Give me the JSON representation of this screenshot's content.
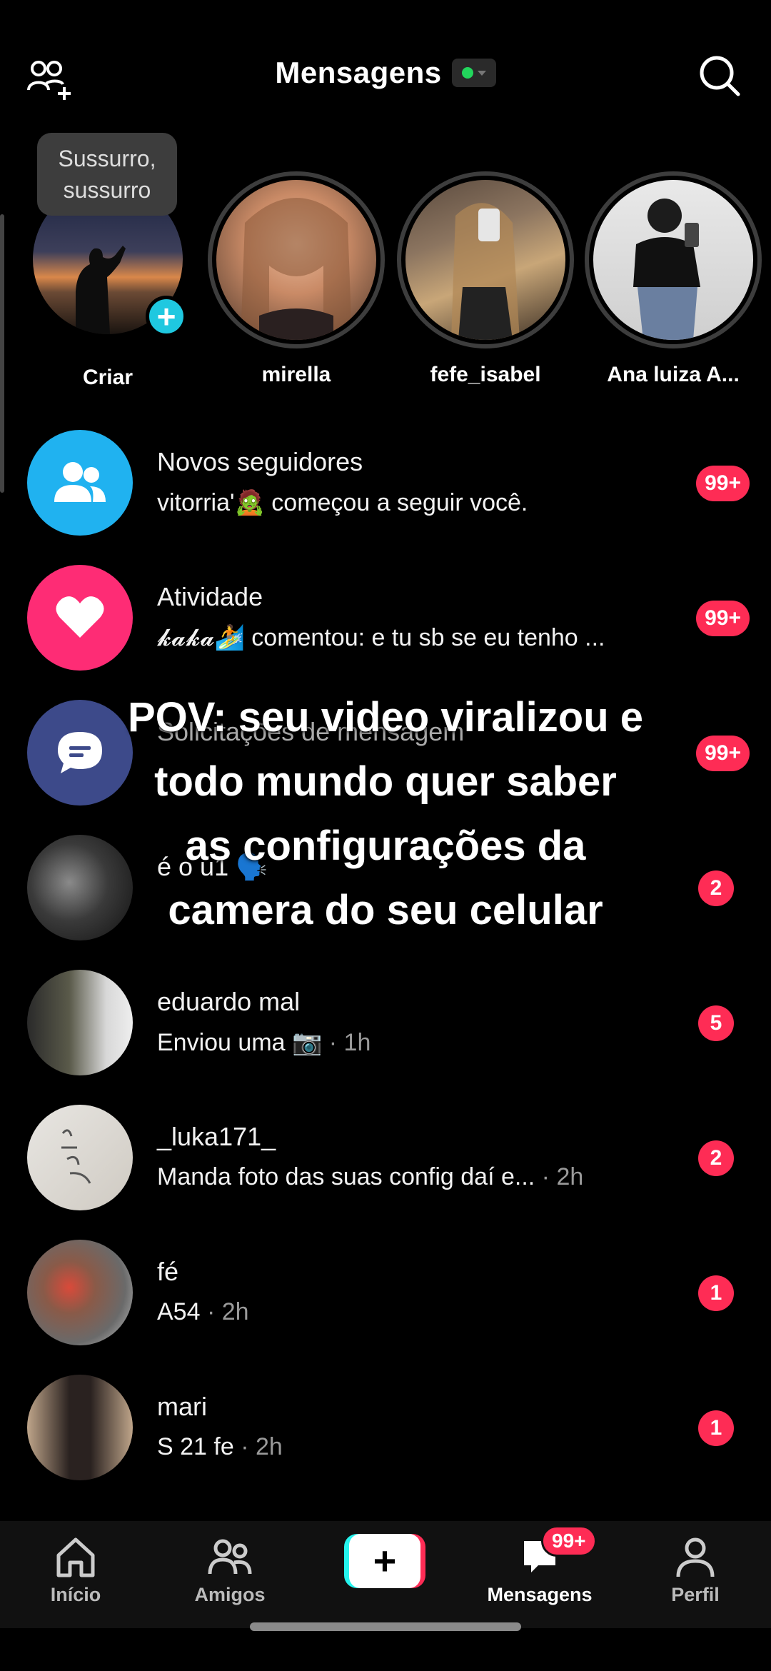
{
  "header": {
    "title": "Mensagens",
    "status": "online",
    "add_friends_icon": "add-friends-icon",
    "search_icon": "search-icon"
  },
  "tooltip": {
    "text": "Sussurro, sussurro"
  },
  "stories": [
    {
      "name": "Criar",
      "is_create": true
    },
    {
      "name": "mirella"
    },
    {
      "name": "fefe_isabel"
    },
    {
      "name": "Ana luiza A..."
    }
  ],
  "conversations": [
    {
      "title": "Novos seguidores",
      "subtitle": "vitorria'🧟 começou a seguir você.",
      "time": "",
      "badge": "99+",
      "icon": "followers-icon",
      "color": "#20b2f0"
    },
    {
      "title": "Atividade",
      "subtitle": "𝓴𝓪𝓴𝓪🏄 comentou: e tu sb se eu tenho ...",
      "time": "",
      "badge": "99+",
      "icon": "heart-icon",
      "color": "#fe2c75"
    },
    {
      "title": "Solicitações de mensagem",
      "subtitle": "",
      "time": "",
      "badge": "99+",
      "icon": "chat-bubble-icon",
      "color": "#3d4a8a"
    },
    {
      "title": "é o u1 🗣️",
      "subtitle": "",
      "time": "",
      "badge": "2"
    },
    {
      "title": "eduardo mal",
      "subtitle": "Enviou uma 📷",
      "time": " · 1h",
      "badge": "5"
    },
    {
      "title": "_luka171_",
      "subtitle": "Manda foto das suas config daí e...",
      "time": " · 2h",
      "badge": "2"
    },
    {
      "title": "fé",
      "subtitle": "A54",
      "time": " · 2h",
      "badge": "1"
    },
    {
      "title": "mari",
      "subtitle": "S 21 fe",
      "time": " · 2h",
      "badge": "1"
    }
  ],
  "overlay_caption": {
    "lines": [
      "POV: seu video viralizou e",
      "todo mundo quer saber",
      "as configurações da",
      "camera do  seu celular"
    ]
  },
  "bottom_nav": {
    "home": "Início",
    "friends": "Amigos",
    "create": "+",
    "messages": "Mensagens",
    "messages_badge": "99+",
    "profile": "Perfil"
  }
}
